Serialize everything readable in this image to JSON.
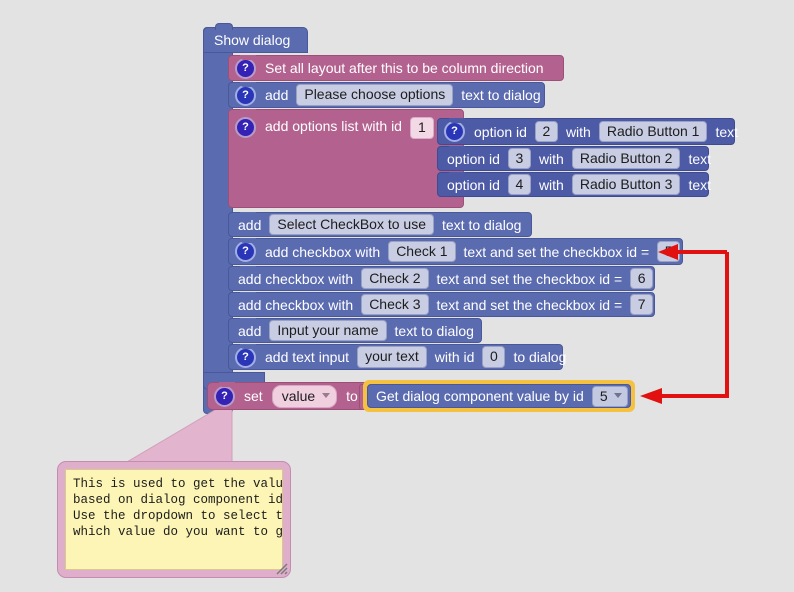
{
  "canvas": {
    "background_color": "#e3e3e3",
    "highlight_color": "#f5c141",
    "arrow_color": "#e11111"
  },
  "program": {
    "root_block": {
      "label": "Show dialog",
      "color": "#5b6bb0"
    },
    "statements": [
      {
        "id": "set-layout",
        "help_icon": "question-mark-icon",
        "color": "#b3628f",
        "text": "Set all layout after this to be column direction"
      },
      {
        "id": "add-prompt-text",
        "help_icon": "question-mark-icon",
        "color": "#5b6bb0",
        "prefix": "add",
        "field": "Please choose options",
        "suffix": "text to dialog"
      },
      {
        "id": "add-options-list",
        "help_icon": "question-mark-icon",
        "color": "#b3628f",
        "prefix": "add options list with id",
        "field": "1",
        "options": [
          {
            "prefix": "option id",
            "id": "2",
            "mid": "with",
            "field": "Radio Button 1",
            "suffix": "text",
            "help_icon": "question-mark-icon"
          },
          {
            "prefix": "option id",
            "id": "3",
            "mid": "with",
            "field": "Radio Button 2",
            "suffix": "text"
          },
          {
            "prefix": "option id",
            "id": "4",
            "mid": "with",
            "field": "Radio Button 3",
            "suffix": "text"
          }
        ]
      },
      {
        "id": "add-checkbox-label",
        "color": "#5b6bb0",
        "prefix": "add",
        "field": "Select CheckBox to use",
        "suffix": "text to dialog"
      },
      {
        "id": "add-checkbox-1",
        "help_icon": "question-mark-icon",
        "color": "#5b6bb0",
        "prefix": "add checkbox with",
        "field": "Check 1",
        "mid": "text and set the checkbox id =",
        "idvalue": "5"
      },
      {
        "id": "add-checkbox-2",
        "color": "#5b6bb0",
        "prefix": "add checkbox with",
        "field": "Check 2",
        "mid": "text and set the checkbox id =",
        "idvalue": "6"
      },
      {
        "id": "add-checkbox-3",
        "color": "#5b6bb0",
        "prefix": "add checkbox with",
        "field": "Check 3",
        "mid": "text and set the checkbox id =",
        "idvalue": "7"
      },
      {
        "id": "add-name-label",
        "color": "#5b6bb0",
        "prefix": "add",
        "field": "Input your name",
        "suffix": "text to dialog"
      },
      {
        "id": "add-text-input",
        "help_icon": "question-mark-icon",
        "color": "#5b6bb0",
        "prefix": "add text input",
        "field": "your text",
        "mid": "with id",
        "idvalue": "0",
        "suffix": "to dialog"
      }
    ],
    "set_value_block": {
      "help_icon": "question-mark-icon",
      "color": "#b3628f",
      "prefix": "set",
      "variable": "value",
      "mid": "to"
    },
    "getter_block": {
      "color": "#5b6bb0",
      "highlight": "#f5c141",
      "text": "Get dialog component value by id",
      "dropdown_value": "5"
    }
  },
  "comment": {
    "text": "This is used to get the value\nbased on dialog component id.\nUse the dropdown to select the\nwhich value do you want to get",
    "bubble_color": "#deaecb",
    "paper_color": "#fdf5b5"
  }
}
